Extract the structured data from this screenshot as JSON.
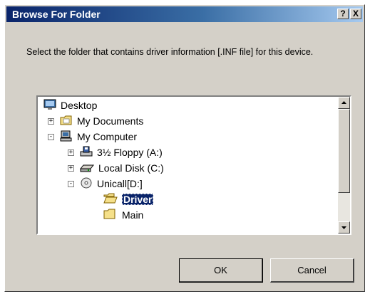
{
  "window": {
    "title": "Browse For Folder",
    "help_label": "?",
    "close_label": "X"
  },
  "prompt": "Select the folder that contains driver information [.INF file] for this device.",
  "tree": {
    "items": [
      {
        "label": "Desktop",
        "icon": "desktop-icon"
      },
      {
        "label": "My Documents",
        "icon": "folder-documents-icon",
        "expander": "+"
      },
      {
        "label": "My Computer",
        "icon": "computer-icon",
        "expander": "-"
      },
      {
        "label": "3½ Floppy (A:)",
        "icon": "floppy-drive-icon",
        "expander": "+"
      },
      {
        "label": "Local Disk (C:)",
        "icon": "hard-drive-icon",
        "expander": "+"
      },
      {
        "label": "Unicall[D:]",
        "icon": "cd-drive-icon",
        "expander": "-"
      },
      {
        "label": "Driver",
        "icon": "folder-open-icon",
        "selected": true
      },
      {
        "label": "Main",
        "icon": "folder-icon"
      }
    ]
  },
  "buttons": {
    "ok": "OK",
    "cancel": "Cancel"
  },
  "colors": {
    "dialog_bg": "#d4d0c8",
    "title_start": "#0a246a",
    "title_end": "#a6caf0",
    "selection": "#0a246a"
  }
}
